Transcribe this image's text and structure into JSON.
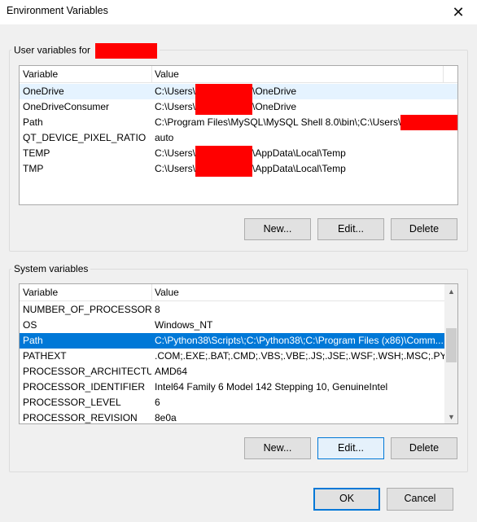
{
  "window": {
    "title": "Environment Variables",
    "close_glyph": "✕"
  },
  "user_section": {
    "label": "User variables for",
    "columns": [
      "Variable",
      "Value"
    ],
    "rows": [
      {
        "variable": "OneDrive",
        "value_prefix": "C:\\Users\\",
        "value_suffix": "\\OneDrive",
        "redacted": true
      },
      {
        "variable": "OneDriveConsumer",
        "value_prefix": "C:\\Users\\",
        "value_suffix": "\\OneDrive",
        "redacted": true
      },
      {
        "variable": "Path",
        "value_prefix": "C:\\Program Files\\MySQL\\MySQL Shell 8.0\\bin\\;C:\\Users\\",
        "value_suffix": "",
        "redacted": true
      },
      {
        "variable": "QT_DEVICE_PIXEL_RATIO",
        "value_prefix": "auto",
        "value_suffix": "",
        "redacted": false
      },
      {
        "variable": "TEMP",
        "value_prefix": "C:\\Users\\",
        "value_suffix": "\\AppData\\Local\\Temp",
        "redacted": true
      },
      {
        "variable": "TMP",
        "value_prefix": "C:\\Users\\",
        "value_suffix": "\\AppData\\Local\\Temp",
        "redacted": true
      }
    ],
    "buttons": {
      "new": "New...",
      "edit": "Edit...",
      "delete": "Delete"
    }
  },
  "system_section": {
    "label": "System variables",
    "columns": [
      "Variable",
      "Value"
    ],
    "rows": [
      {
        "variable": "NUMBER_OF_PROCESSORS",
        "value": "8"
      },
      {
        "variable": "OS",
        "value": "Windows_NT"
      },
      {
        "variable": "Path",
        "value": "C:\\Python38\\Scripts\\;C:\\Python38\\;C:\\Program Files (x86)\\Comm..."
      },
      {
        "variable": "PATHEXT",
        "value": ".COM;.EXE;.BAT;.CMD;.VBS;.VBE;.JS;.JSE;.WSF;.WSH;.MSC;.PY;.PYW"
      },
      {
        "variable": "PROCESSOR_ARCHITECTURE",
        "value": "AMD64"
      },
      {
        "variable": "PROCESSOR_IDENTIFIER",
        "value": "Intel64 Family 6 Model 142 Stepping 10, GenuineIntel"
      },
      {
        "variable": "PROCESSOR_LEVEL",
        "value": "6"
      },
      {
        "variable": "PROCESSOR_REVISION",
        "value": "8e0a"
      }
    ],
    "selected_row": "Path",
    "buttons": {
      "new": "New...",
      "edit": "Edit...",
      "delete": "Delete"
    }
  },
  "footer": {
    "ok": "OK",
    "cancel": "Cancel"
  },
  "colors": {
    "selection": "#0078d7",
    "redaction": "#ff0000",
    "hover_row": "#e5f3ff"
  }
}
